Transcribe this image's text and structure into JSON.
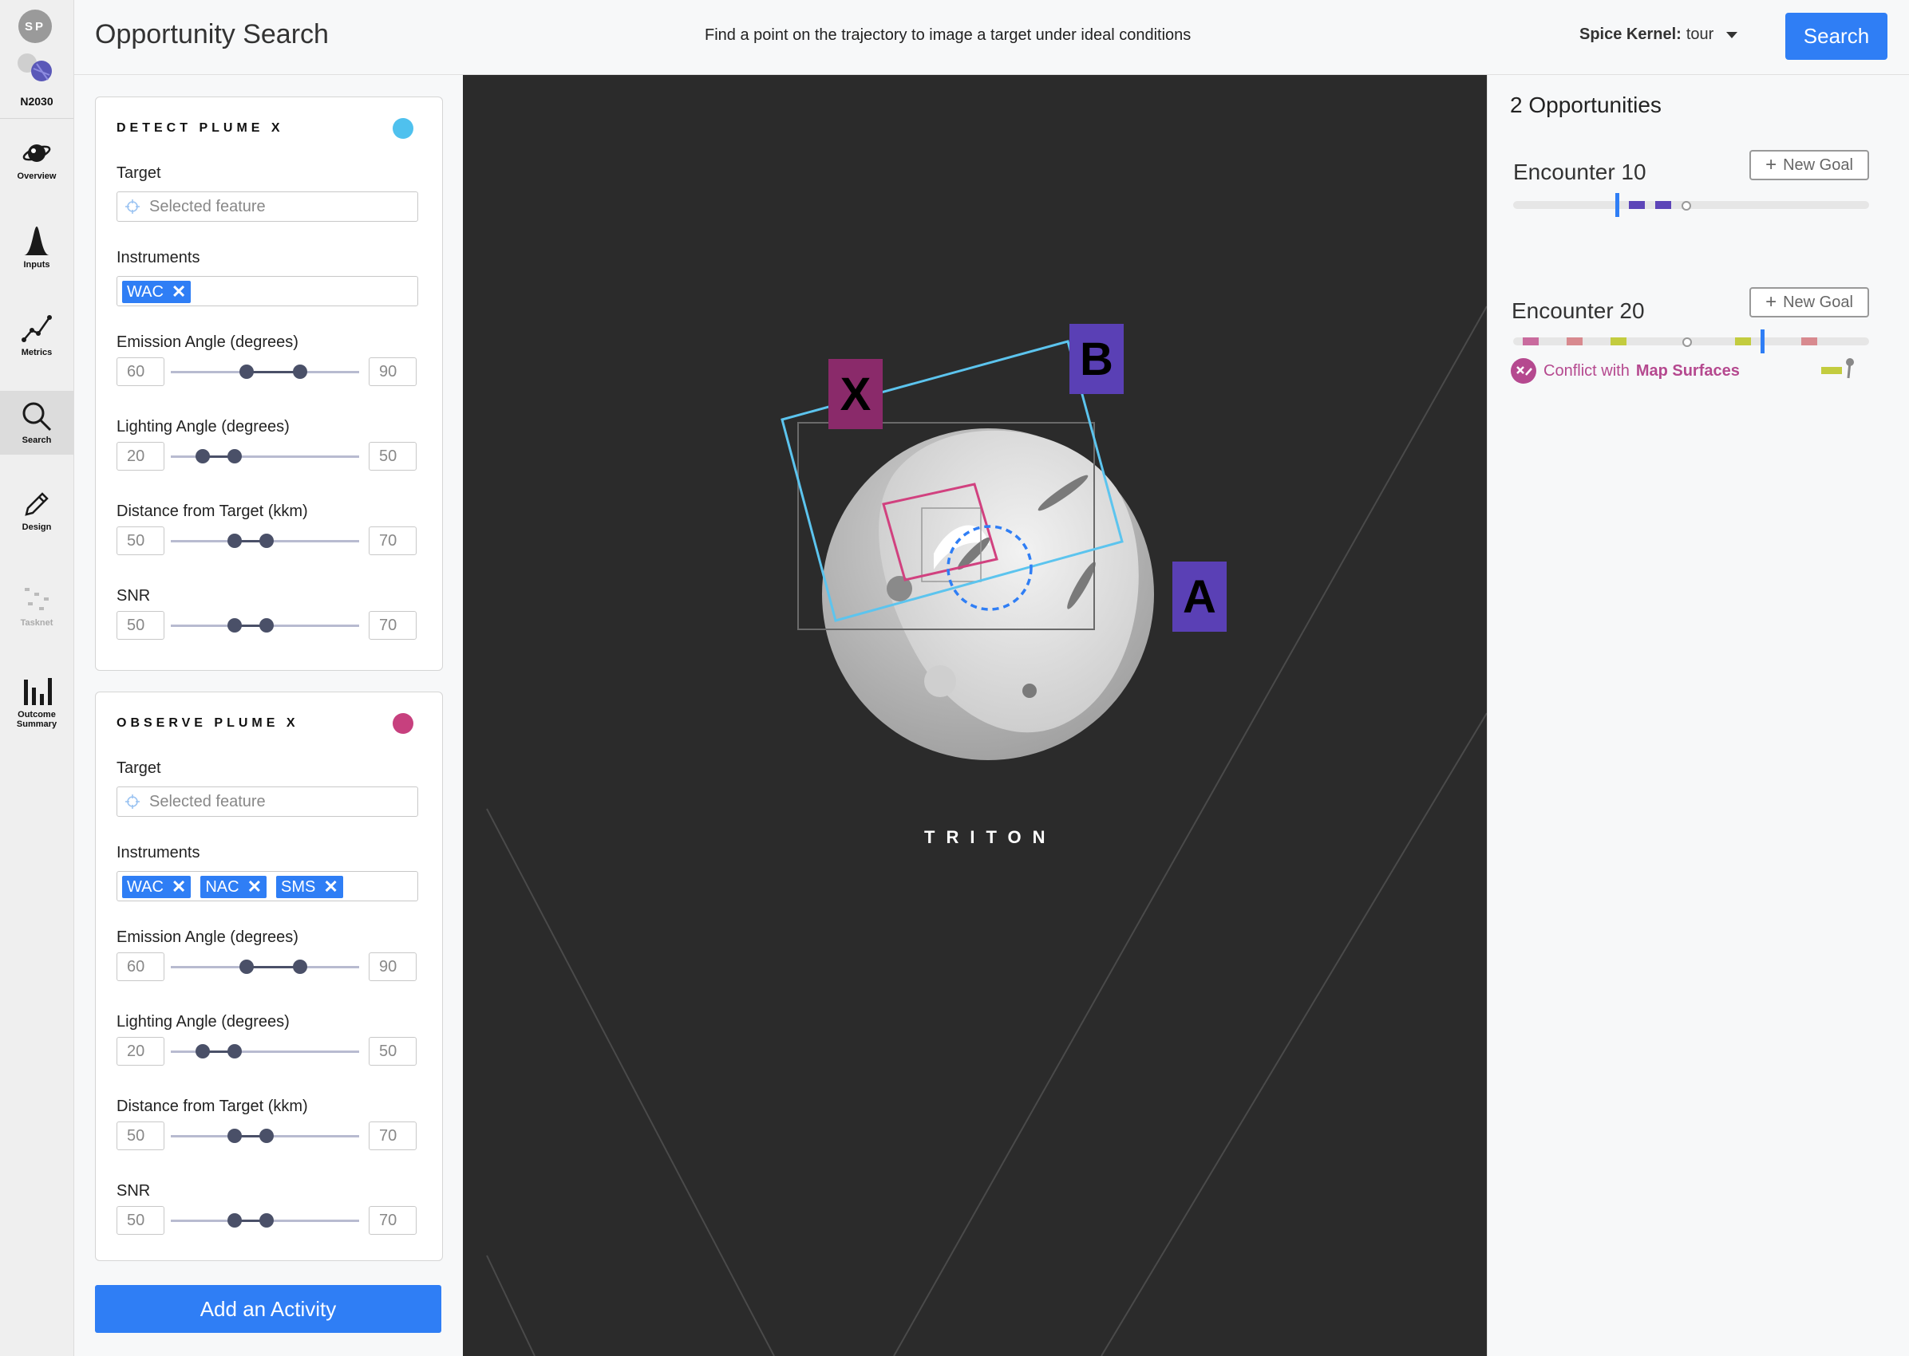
{
  "user": {
    "initials": "SP"
  },
  "mission": {
    "name": "N2030"
  },
  "nav": {
    "items": [
      {
        "label": "Overview"
      },
      {
        "label": "Inputs"
      },
      {
        "label": "Metrics"
      },
      {
        "label": "Search"
      },
      {
        "label": "Design"
      },
      {
        "label": "Tasknet"
      },
      {
        "label": "Outcome Summary"
      }
    ]
  },
  "header": {
    "title": "Opportunity Search",
    "subtitle": "Find a point on the trajectory to image a target under ideal conditions",
    "kernel_label": "Spice Kernel:",
    "kernel_value": "tour",
    "search_label": "Search"
  },
  "activities": [
    {
      "title": "DETECT PLUME X",
      "color": "#4fc1ee",
      "target_label": "Target",
      "target_placeholder": "Selected feature",
      "instruments_label": "Instruments",
      "instruments": [
        "WAC"
      ],
      "ranges": [
        {
          "label": "Emission Angle (degrees)",
          "min": "60",
          "max": "90"
        },
        {
          "label": "Lighting Angle (degrees)",
          "min": "20",
          "max": "50"
        },
        {
          "label": "Distance from Target (kkm)",
          "min": "50",
          "max": "70"
        },
        {
          "label": "SNR",
          "min": "50",
          "max": "70"
        }
      ]
    },
    {
      "title": "OBSERVE PLUME X",
      "color": "#c7407e",
      "target_label": "Target",
      "target_placeholder": "Selected feature",
      "instruments_label": "Instruments",
      "instruments": [
        "WAC",
        "NAC",
        "SMS"
      ],
      "ranges": [
        {
          "label": "Emission Angle (degrees)",
          "min": "60",
          "max": "90"
        },
        {
          "label": "Lighting Angle (degrees)",
          "min": "20",
          "max": "50"
        },
        {
          "label": "Distance from Target (kkm)",
          "min": "50",
          "max": "70"
        },
        {
          "label": "SNR",
          "min": "50",
          "max": "70"
        }
      ]
    }
  ],
  "add_activity_label": "Add an Activity",
  "viz": {
    "body_name": "TRITON",
    "tags": [
      {
        "label": "X",
        "color": "#8a2a6a"
      },
      {
        "label": "B",
        "color": "#5a40b5"
      },
      {
        "label": "A",
        "color": "#5a40b5"
      }
    ]
  },
  "opportunities": {
    "count_label": "2 Opportunities",
    "encounters": [
      {
        "title": "Encounter 10",
        "new_goal_label": "New Goal"
      },
      {
        "title": "Encounter 20",
        "new_goal_label": "New Goal",
        "conflict_prefix": "Conflict with",
        "conflict_target": "Map Surfaces"
      }
    ]
  }
}
